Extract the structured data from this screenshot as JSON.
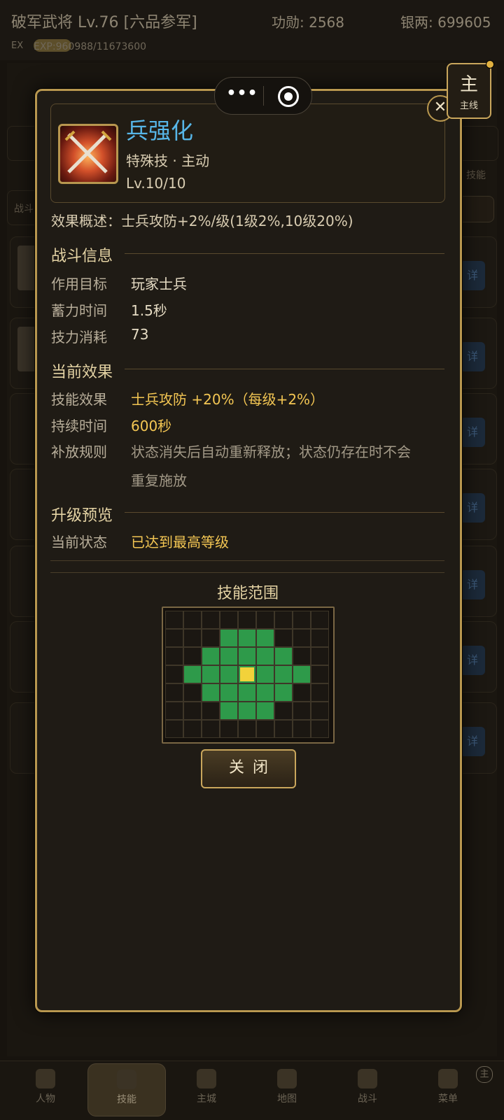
{
  "top": {
    "title": "破军武将 Lv.76 [六品参军]",
    "merit": "功勋: 2568",
    "silver": "银两: 699605",
    "ex_label": "EX",
    "exp": "EXP:960988/11673600"
  },
  "background": {
    "heading": "技能",
    "tab_label": "战斗",
    "skill_tab": "技能",
    "row_button": "详"
  },
  "capsule": {
    "menu_icon": "more-dots-icon",
    "target_icon": "target-icon"
  },
  "main_quest": {
    "big": "主",
    "small": "主线"
  },
  "skill": {
    "name": "兵强化",
    "type": "特殊技 · 主动",
    "level": "Lv.10/10",
    "summary": "效果概述：士兵攻防+2%/级(1级2%,10级20%)"
  },
  "sections": {
    "battle": {
      "title": "战斗信息",
      "rows": [
        {
          "label": "作用目标",
          "value": "玩家士兵"
        },
        {
          "label": "蓄力时间",
          "value": "1.5秒"
        },
        {
          "label": "技力消耗",
          "value": "73"
        }
      ]
    },
    "effect": {
      "title": "当前效果",
      "rows": [
        {
          "label": "技能效果",
          "value": "士兵攻防 +20%（每级+2%）"
        },
        {
          "label": "持续时间",
          "value": "600秒"
        },
        {
          "label": "补放规则",
          "value_line1": "状态消失后自动重新释放；状态仍存在时不会",
          "value_line2": "重复施放"
        }
      ]
    },
    "upgrade": {
      "title": "升级预览",
      "rows": [
        {
          "label": "当前状态",
          "value": "已达到最高等级"
        }
      ]
    }
  },
  "range": {
    "title": "技能范围",
    "cols": 9,
    "rows": 7,
    "colors": {
      "empty": "#1b1712",
      "area": "#2e9a4a",
      "center": "#f2d23a"
    },
    "area_cells": [
      [
        1,
        3
      ],
      [
        1,
        4
      ],
      [
        1,
        5
      ],
      [
        2,
        2
      ],
      [
        2,
        3
      ],
      [
        2,
        4
      ],
      [
        2,
        5
      ],
      [
        2,
        6
      ],
      [
        3,
        1
      ],
      [
        3,
        2
      ],
      [
        3,
        3
      ],
      [
        3,
        5
      ],
      [
        3,
        6
      ],
      [
        3,
        7
      ],
      [
        4,
        2
      ],
      [
        4,
        3
      ],
      [
        4,
        4
      ],
      [
        4,
        5
      ],
      [
        4,
        6
      ],
      [
        5,
        3
      ],
      [
        5,
        4
      ],
      [
        5,
        5
      ]
    ],
    "center_cell": [
      3,
      4
    ]
  },
  "close_button": "关闭",
  "nav": [
    {
      "label": "人物",
      "icon": "character-icon"
    },
    {
      "label": "技能",
      "icon": "scroll-icon",
      "active": true
    },
    {
      "label": "主城",
      "icon": "castle-icon"
    },
    {
      "label": "地图",
      "icon": "map-icon"
    },
    {
      "label": "战斗",
      "icon": "crossed-swords-icon"
    },
    {
      "label": "菜单",
      "icon": "menu-book-icon"
    }
  ],
  "nav_badge": "主"
}
